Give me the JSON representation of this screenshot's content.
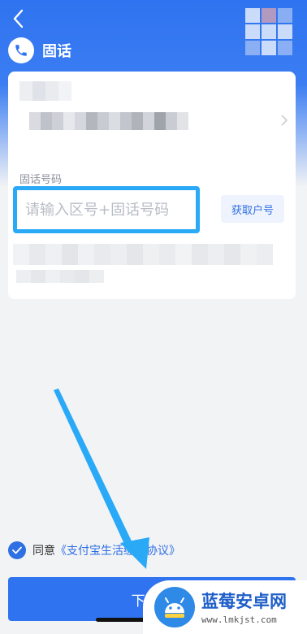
{
  "header": {
    "title": "固话",
    "back_icon": "back-chevron-icon",
    "badge_icon": "phone-icon"
  },
  "form": {
    "field_label": "固话号码",
    "phone_placeholder": "请输入区号+固话号码",
    "get_account_label": "获取户号"
  },
  "agreement": {
    "agree_label": "同意",
    "link_text": "《支付宝生活缴费协议》"
  },
  "footer": {
    "next_label": "下一步"
  },
  "watermark": {
    "title": "蓝莓安卓网",
    "url": "www.lmkjst.com"
  },
  "colors": {
    "primary": "#2f73f0",
    "highlight_box": "#2aa9f7",
    "arrow": "#2aa9f7"
  }
}
